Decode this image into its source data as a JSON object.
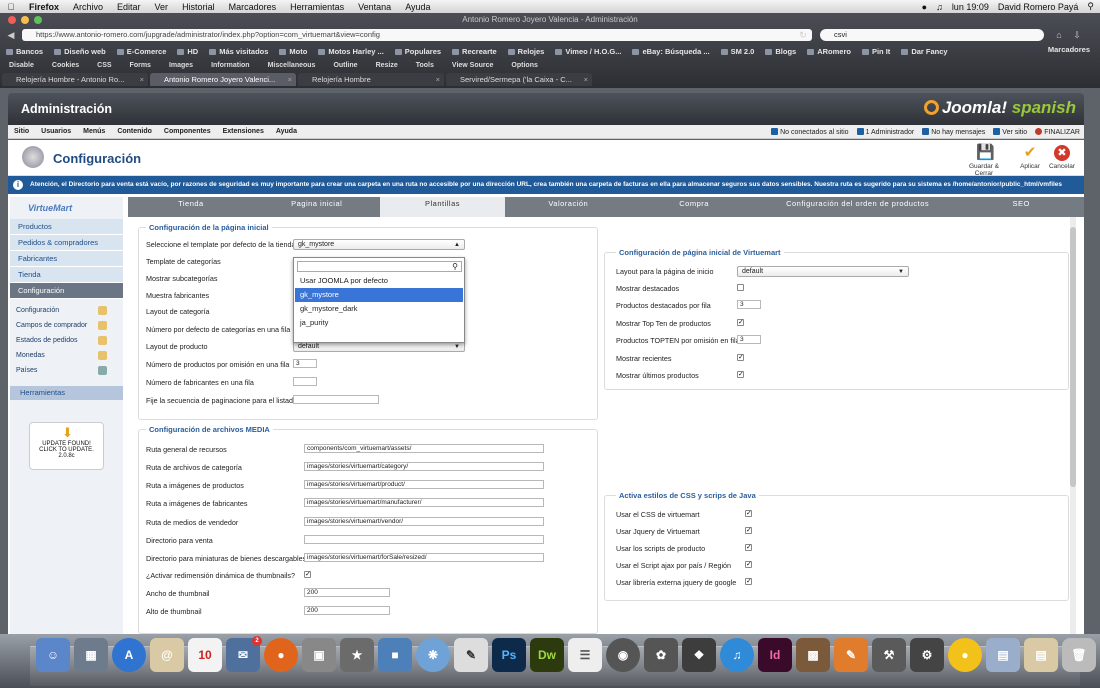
{
  "macmenu": {
    "app": "Firefox",
    "items": [
      "Archivo",
      "Editar",
      "Ver",
      "Historial",
      "Marcadores",
      "Herramientas",
      "Ventana",
      "Ayuda"
    ],
    "clock": "lun 19:09",
    "user": "David Romero Payá"
  },
  "window_title": "Antonio Romero Joyero Valencia - Administración",
  "url": "https://www.antonio-romero.com/jupgrade/administrator/index.php?option=com_virtuemart&view=config",
  "search_value": "csvi",
  "bookmarks": [
    "Bancos",
    "Diseño web",
    "E-Comerce",
    "HD",
    "Más visitados",
    "Moto",
    "Motos Harley ...",
    "Populares",
    "Recrearte",
    "Relojes",
    "Vimeo / H.O.G...",
    "eBay: Búsqueda ...",
    "SM 2.0",
    "Blogs",
    "ARomero",
    "Pin It",
    "Dar Fancy"
  ],
  "bookmarks_right": "Marcadores",
  "devbar": [
    "Disable",
    "Cookies",
    "CSS",
    "Forms",
    "Images",
    "Information",
    "Miscellaneous",
    "Outline",
    "Resize",
    "Tools",
    "View Source",
    "Options"
  ],
  "tabs": [
    "Relojería Hombre - Antonio Ro...",
    "Antonio Romero Joyero Valenci...",
    "Relojería Hombre",
    "Servired/Sermepa ('la Caixa - C..."
  ],
  "admin": {
    "title": "Administración",
    "brand": "Joomla!",
    "brand_lang": "spanish"
  },
  "menu": {
    "items": [
      "Sitio",
      "Usuarios",
      "Menús",
      "Contenido",
      "Componentes",
      "Extensiones",
      "Ayuda"
    ],
    "status": [
      "No conectados al sitio",
      "1 Administrador",
      "No hay mensajes",
      "Ver sitio",
      "FINALIZAR"
    ]
  },
  "toolbar": {
    "title": "Configuración",
    "save_close": "Guardar & Cerrar",
    "apply": "Aplicar",
    "cancel": "Cancelar"
  },
  "notice": "Atención, el Directorio para venta está vacío, por razones de seguridad es muy importante para crear una carpeta en una ruta no accesible por una dirección URL, crea también una carpeta de facturas en ella para almacenar seguros sus datos sensibles. Nuestra ruta es sugerido para su sistema es /home/antonior/public_html/vmfiles",
  "sidebar": {
    "logo": "VirtueMart",
    "main": [
      "Productos",
      "Pedidos & compradores",
      "Fabricantes",
      "Tienda",
      "Configuración"
    ],
    "sub": [
      "Configuración",
      "Campos de comprador",
      "Estados de pedidos",
      "Monedas",
      "Países"
    ],
    "tools": "Herramientas",
    "update": [
      "UPDATE FOUND!",
      "CLICK TO UPDATE.",
      "2.0.8c"
    ]
  },
  "vmtabs": [
    "Tienda",
    "Pagina inicial",
    "Plantillas",
    "Valoración",
    "Compra",
    "Configuración del orden de productos",
    "SEO"
  ],
  "home_cfg": {
    "legend": "Configuración de la página inicial",
    "labels": [
      "Seleccione el template por defecto de la tienda",
      "Template de categorías",
      "Mostrar subcategorías",
      "Muestra fabricantes",
      "Layout de categoría",
      "Número por defecto de categorías en una fila",
      "Layout de producto",
      "Número de productos por omisión en una fila",
      "Número de fabricantes en una fila",
      "Fije la secuencia de paginacione para el listado"
    ],
    "template_value": "gk_mystore",
    "product_layout": "default",
    "products_per_row": "3"
  },
  "dropdown": {
    "options": [
      "Usar JOOMLA por defecto",
      "gk_mystore",
      "gk_mystore_dark",
      "ja_purity"
    ],
    "selected": "gk_mystore"
  },
  "media_cfg": {
    "legend": "Configuración de archivos MEDIA",
    "labels": [
      "Ruta general de recursos",
      "Ruta de archivos de categoría",
      "Ruta a imágenes de productos",
      "Ruta a imágenes de fabricantes",
      "Ruta de medios de vendedor",
      "Directorio para venta",
      "Directorio para miniaturas de bienes descargables",
      "¿Activar redimensión dinámica de thumbnails?",
      "Ancho de thumbnail",
      "Alto de thumbnail"
    ],
    "values": [
      "components/com_virtuemart/assets/",
      "images/stories/virtuemart/category/",
      "images/stories/virtuemart/product/",
      "images/stories/virtuemart/manufacturer/",
      "images/stories/virtuemart/vendor/",
      "",
      "images/stories/virtuemart/forSale/resized/",
      "",
      "200",
      "200"
    ]
  },
  "vm_home": {
    "legend": "Configuración de página inicial de Virtuemart",
    "labels": [
      "Layout para la página de inicio",
      "Mostrar destacados",
      "Productos destacados por fila",
      "Mostrar Top Ten de productos",
      "Productos TOPTEN por omisión en fila",
      "Mostrar recientes",
      "Mostrar últimos productos"
    ],
    "layout": "default",
    "featured_per_row": "3",
    "topten_per_row": "3"
  },
  "css_cfg": {
    "legend": "Activa estilos de CSS y scrips de Java",
    "labels": [
      "Usar el CSS de virtuemart",
      "Usar Jquery de Virtuemart",
      "Usar los scripts de producto",
      "Usar el Script ajax por país / Región",
      "Usar librería externa jquery de google"
    ]
  },
  "dock": {
    "date": "10",
    "mail_badge": "2",
    "apps": [
      "Ps",
      "Dw",
      "Id"
    ]
  }
}
